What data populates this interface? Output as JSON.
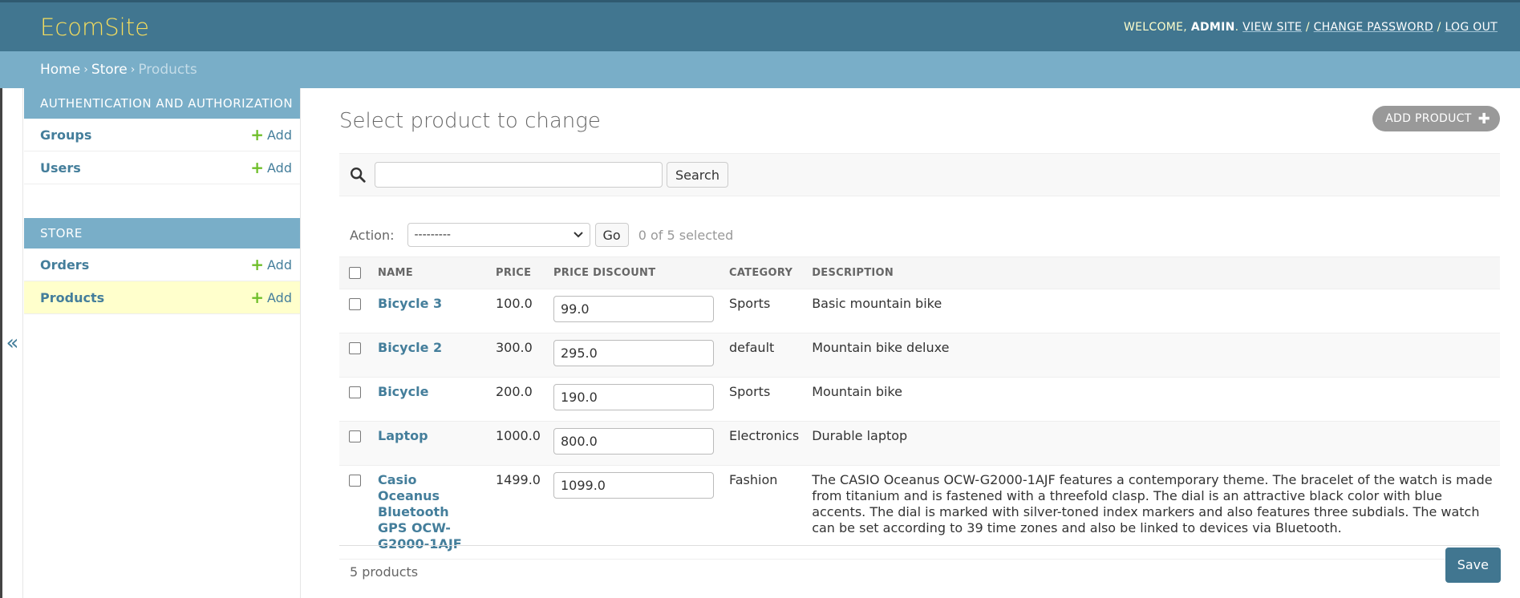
{
  "header": {
    "site_name": "EcomSite",
    "welcome": "WELCOME,",
    "username": "ADMIN",
    "view_site": "VIEW SITE",
    "change_password": "CHANGE PASSWORD",
    "log_out": "LOG OUT"
  },
  "breadcrumbs": {
    "home": "Home",
    "store": "Store",
    "current": "Products"
  },
  "sidebar": {
    "toggle": "«",
    "modules": [
      {
        "caption": "AUTHENTICATION AND AUTHORIZATION",
        "items": [
          {
            "label": "Groups",
            "add": "Add"
          },
          {
            "label": "Users",
            "add": "Add"
          }
        ]
      },
      {
        "caption": "STORE",
        "items": [
          {
            "label": "Orders",
            "add": "Add"
          },
          {
            "label": "Products",
            "add": "Add",
            "current": true
          }
        ]
      }
    ]
  },
  "main": {
    "title": "Select product to change",
    "add_button": "ADD PRODUCT",
    "search": {
      "value": "",
      "button": "Search"
    },
    "actions": {
      "label": "Action:",
      "selected": "---------",
      "go": "Go",
      "counter": "0 of 5 selected"
    },
    "table": {
      "headers": [
        "NAME",
        "PRICE",
        "PRICE DISCOUNT",
        "CATEGORY",
        "DESCRIPTION"
      ],
      "rows": [
        {
          "name": "Bicycle 3",
          "price": "100.0",
          "discount": "99.0",
          "category": "Sports",
          "description": "Basic mountain bike"
        },
        {
          "name": "Bicycle 2",
          "price": "300.0",
          "discount": "295.0",
          "category": "default",
          "description": "Mountain bike deluxe"
        },
        {
          "name": "Bicycle",
          "price": "200.0",
          "discount": "190.0",
          "category": "Sports",
          "description": "Mountain bike"
        },
        {
          "name": "Laptop",
          "price": "1000.0",
          "discount": "800.0",
          "category": "Electronics",
          "description": "Durable laptop"
        },
        {
          "name": "Casio Oceanus Bluetooth GPS OCW-G2000-1AJF",
          "price": "1499.0",
          "discount": "1099.0",
          "category": "Fashion",
          "description": "The CASIO Oceanus OCW-G2000-1AJF features a contemporary theme. The bracelet of the watch is made from titanium and is fastened with a threefold clasp. The dial is an attractive black color with blue accents. The dial is marked with silver-toned index markers and also features three subdials. The watch can be set according to 39 time zones and also be linked to devices via Bluetooth."
        }
      ]
    },
    "paginator": "5 products",
    "save_button": "Save"
  },
  "colors": {
    "header": "#417690",
    "brand": "#f5dd5d",
    "breadcrumbs": "#79aec8",
    "link": "#447e9b",
    "add_icon": "#70bf2b",
    "current_row": "#ffffcc"
  }
}
